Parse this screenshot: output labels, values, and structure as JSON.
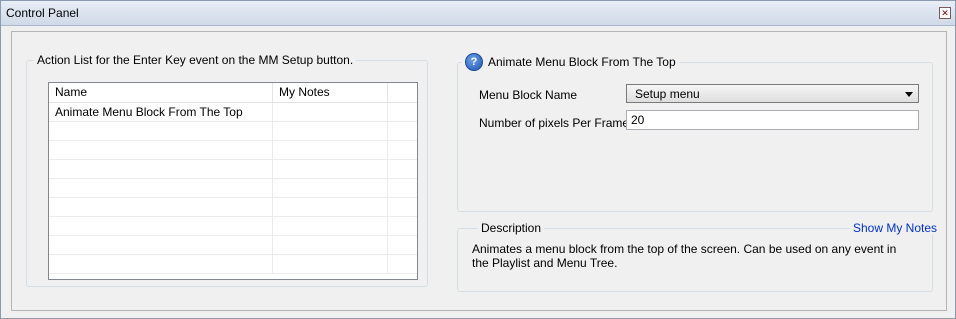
{
  "window": {
    "title": "Control Panel",
    "close_glyph": "✕"
  },
  "action_list": {
    "legend": "Action List for the Enter Key event on the MM Setup button.",
    "columns": [
      "Name",
      "My Notes",
      ""
    ],
    "rows": [
      {
        "name": "Animate Menu Block From The Top",
        "notes": ""
      },
      {
        "name": "",
        "notes": ""
      },
      {
        "name": "",
        "notes": ""
      },
      {
        "name": "",
        "notes": ""
      },
      {
        "name": "",
        "notes": ""
      },
      {
        "name": "",
        "notes": ""
      },
      {
        "name": "",
        "notes": ""
      },
      {
        "name": "",
        "notes": ""
      },
      {
        "name": "",
        "notes": ""
      }
    ]
  },
  "properties": {
    "legend": "Animate Menu Block From The Top",
    "help_icon_glyph": "?",
    "menu_block_label": "Menu Block Name",
    "menu_block_value": "Setup menu",
    "pixels_label": "Number of pixels Per Frame",
    "pixels_value": "20"
  },
  "description": {
    "legend": "Description",
    "show_notes": "Show My Notes",
    "text": "Animates a menu block from the top of the screen.  Can be used on any event in the Playlist and Menu Tree."
  }
}
